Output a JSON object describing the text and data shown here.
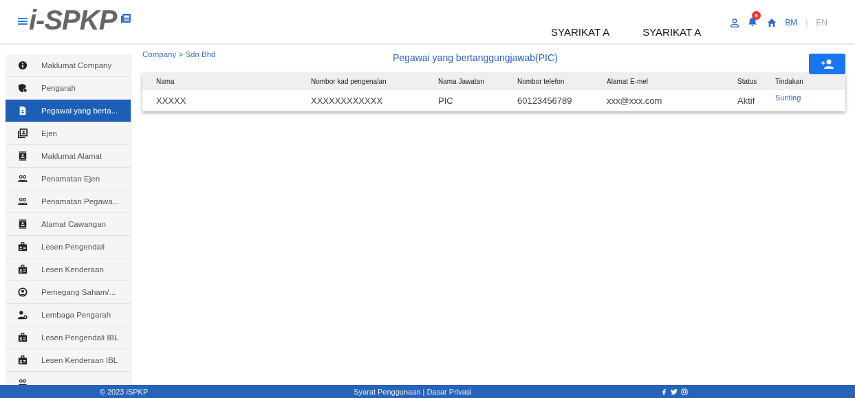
{
  "header": {
    "logo": "i-SPKP",
    "companies": [
      "SYARIKAT A",
      "SYARIKAT A"
    ],
    "notification_count": "6",
    "languages": [
      {
        "label": "BM",
        "selected": true
      },
      {
        "label": "EN",
        "selected": false
      }
    ],
    "language_separator": "|"
  },
  "sidebar": {
    "items": [
      {
        "label": "Maklumat Company",
        "selected": false
      },
      {
        "label": "Pengarah",
        "selected": false
      },
      {
        "label": "Pegawai yang berta...",
        "selected": true
      },
      {
        "label": "Ejen",
        "selected": false
      },
      {
        "label": "Maklumat Alamat",
        "selected": false
      },
      {
        "label": "Penamatan Ejen",
        "selected": false
      },
      {
        "label": "Penamatan Pegawa...",
        "selected": false
      },
      {
        "label": "Alamat Cawangan",
        "selected": false
      },
      {
        "label": "Lesen Pengendali",
        "selected": false
      },
      {
        "label": "Lesen Kenderaan",
        "selected": false
      },
      {
        "label": "Pemegang Saham/...",
        "selected": false
      },
      {
        "label": "Lembaga Pengarah",
        "selected": false
      },
      {
        "label": "Lesen Pengendali IBL",
        "selected": false
      },
      {
        "label": "Lesen Kenderaan IBL",
        "selected": false
      }
    ]
  },
  "breadcrumb": "Company > Sdn Bhd",
  "page_title": "Pegawai yang bertanggungjawab(PIC)",
  "table": {
    "columns": [
      "Nama",
      "Nombor kad pengenalan",
      "Nama Jawatan",
      "Nombor telefon",
      "Alamat E-mel",
      "Status",
      "Tindakan"
    ],
    "rows": [
      [
        "XXXXX",
        "XXXXXXXXXXXX",
        "PIC",
        "60123456789",
        "xxx@xxx.com",
        "Aktif",
        "Sunting"
      ]
    ]
  },
  "footer": {
    "copyright": "© 2023 iSPKP",
    "links": "Syarat Penggunaan | Dasar Privasi"
  }
}
